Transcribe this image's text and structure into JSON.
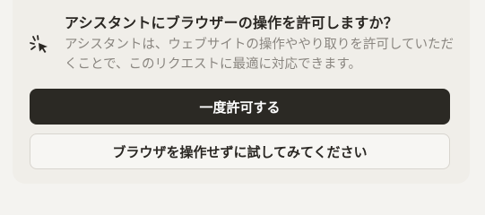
{
  "dialog": {
    "title": "アシスタントにブラウザーの操作を許可しますか？",
    "description": "アシスタントは、ウェブサイトの操作ややり取りを許可していただくことで、このリクエストに最適に対応できます。",
    "icon": "sparkle-cursor-icon"
  },
  "actions": {
    "allow_once_label": "一度許可する",
    "try_without_label": "ブラウザを操作せずに試してみてください"
  },
  "colors": {
    "primary_button_bg": "#2b2924",
    "card_bg": "#f0eee9",
    "text": "#2a2723",
    "muted_text": "#8a8680"
  }
}
